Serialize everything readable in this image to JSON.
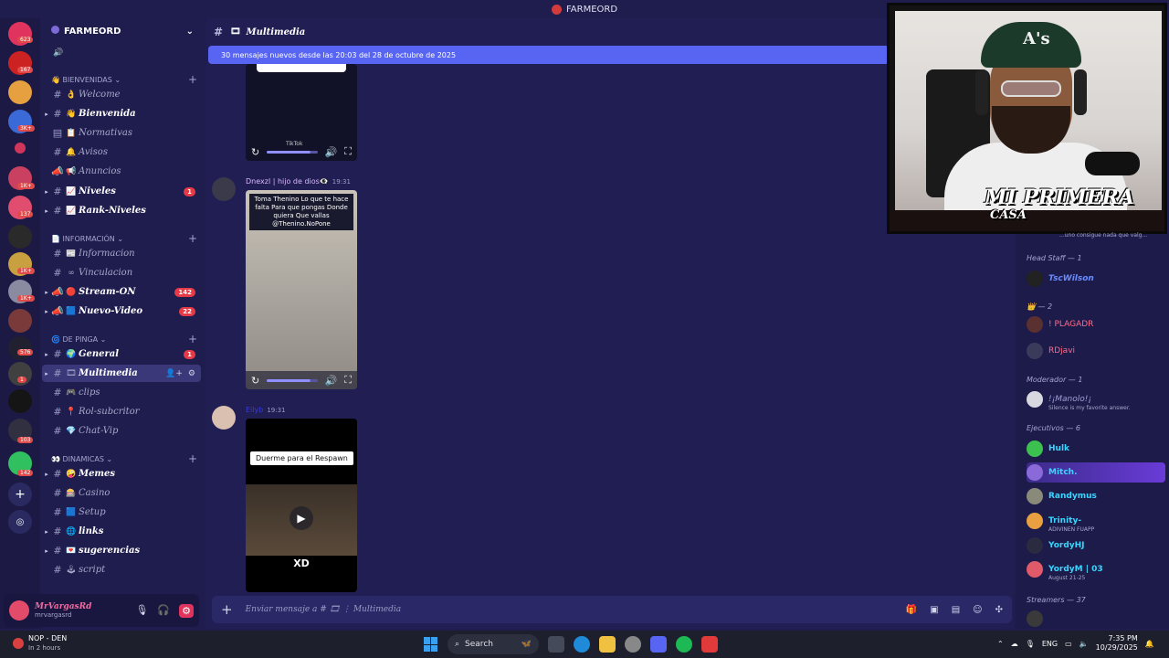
{
  "window": {
    "title": "FARMEORD"
  },
  "server_rail": {
    "badges": [
      "623",
      "167",
      "3K+",
      "1K+",
      "137",
      "1K+",
      "1K+",
      "576",
      "1",
      "103",
      "142"
    ]
  },
  "guild": {
    "name": "FARMEORD"
  },
  "categories": [
    {
      "label": "BIENVENIDAS"
    },
    {
      "label": "INFORMACIÓN"
    },
    {
      "label": "DE PINGA"
    },
    {
      "label": "DINAMICAS"
    }
  ],
  "channels": [
    {
      "name": "Welcome",
      "emoji": "👌",
      "bold": false,
      "count": ""
    },
    {
      "name": "Bienvenida",
      "emoji": "👋",
      "bold": true,
      "count": ""
    },
    {
      "name": "Normativas",
      "emoji": "📋",
      "bold": false,
      "count": ""
    },
    {
      "name": "Avisos",
      "emoji": "🔔",
      "bold": false,
      "count": ""
    },
    {
      "name": "Anuncios",
      "emoji": "📢",
      "bold": false,
      "count": ""
    },
    {
      "name": "Niveles",
      "emoji": "📈",
      "bold": true,
      "count": "1"
    },
    {
      "name": "Rank-Niveles",
      "emoji": "📈",
      "bold": true,
      "count": ""
    },
    {
      "name": "Informacion",
      "emoji": "📰",
      "bold": false,
      "count": ""
    },
    {
      "name": "Vinculacion",
      "emoji": "∞",
      "bold": false,
      "count": ""
    },
    {
      "name": "Stream-ON",
      "emoji": "🔴",
      "bold": true,
      "count": "142"
    },
    {
      "name": "Nuevo-Video",
      "emoji": "🟦",
      "bold": true,
      "count": "22"
    },
    {
      "name": "General",
      "emoji": "🌍",
      "bold": true,
      "count": "1"
    },
    {
      "name": "Multimedia",
      "emoji": "🎞",
      "bold": true,
      "count": ""
    },
    {
      "name": "clips",
      "emoji": "🎮",
      "bold": false,
      "count": ""
    },
    {
      "name": "Rol-subcritor",
      "emoji": "📍",
      "bold": false,
      "count": ""
    },
    {
      "name": "Chat-Vip",
      "emoji": "💎",
      "bold": false,
      "count": ""
    },
    {
      "name": "Memes",
      "emoji": "🤪",
      "bold": true,
      "count": ""
    },
    {
      "name": "Casino",
      "emoji": "🎰",
      "bold": false,
      "count": ""
    },
    {
      "name": "Setup",
      "emoji": "🟦",
      "bold": false,
      "count": ""
    },
    {
      "name": "links",
      "emoji": "🌐",
      "bold": true,
      "count": ""
    },
    {
      "name": "sugerencias",
      "emoji": "💌",
      "bold": true,
      "count": ""
    },
    {
      "name": "script",
      "emoji": "🕹",
      "bold": false,
      "count": ""
    }
  ],
  "user": {
    "name": "MrVargasRd",
    "tag": "mrvargasrd"
  },
  "chat": {
    "channel_name": "Multimedia",
    "new_messages_banner": "30 mensajes nuevos desde las 20:03 del 28 de octubre de 2025",
    "messages": [
      {
        "author": "Dnexzl | hijo de dios👁‍🗨",
        "time": "19:31",
        "caption": "Toma Thenino Lo que te hace falta Para que pongas Donde quiera Que vallas @Thenino.NoPone"
      },
      {
        "author": "Eilyb",
        "time": "19:31",
        "pill": "Duerme para el Respawn",
        "footer": "XD"
      }
    ],
    "composer_placeholder": "Enviar mensaje a # 🎞 ⋮ Multimedia",
    "tiktok_label": "TikTok"
  },
  "members": {
    "groups": [
      {
        "label": "Head Staff — 1"
      },
      {
        "label": "👑 — 2"
      },
      {
        "label": "Moderador — 1"
      },
      {
        "label": "Ejecutivos — 6"
      },
      {
        "label": "Streamers — 37"
      }
    ],
    "people": [
      {
        "name": "TscWilson",
        "status": "",
        "color": "#6a8cff"
      },
      {
        "name": "! PLAGADR",
        "status": "",
        "color": "#ff6b8a"
      },
      {
        "name": "RDjavi",
        "status": "",
        "color": "#ff6b8a"
      },
      {
        "name": "!¡Manolo!¡",
        "status": "Silence is my favorite answer.",
        "color": "#9fa0d8"
      },
      {
        "name": "Hulk",
        "status": "",
        "color": "#39d7ff"
      },
      {
        "name": "Mitch.",
        "status": "",
        "color": "#39d7ff"
      },
      {
        "name": "Randymus",
        "status": "",
        "color": "#39d7ff"
      },
      {
        "name": "Trinity-",
        "status": "ADIVINEN FUAPP",
        "color": "#39d7ff"
      },
      {
        "name": "YordyHJ",
        "status": "",
        "color": "#39d7ff"
      },
      {
        "name": "YordyM | 03",
        "status": "August 21-25",
        "color": "#39d7ff"
      }
    ],
    "ticker": "...uno consigue nada que valg..."
  },
  "webcam": {
    "brand_line1": "MI PRIMERA",
    "brand_line2": "CASA"
  },
  "taskbar": {
    "weather_title": "NOP - DEN",
    "weather_sub": "In 2 hours",
    "search": "Search",
    "lang": "ENG",
    "time": "7:35 PM",
    "date": "10/29/2025"
  }
}
